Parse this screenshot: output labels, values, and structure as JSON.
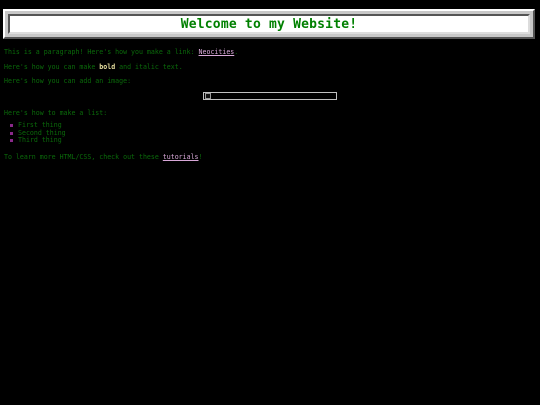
{
  "banner": {
    "title": "Welcome to my Website!"
  },
  "paragraph1": {
    "text": "This is a paragraph! Here's how you make a link: ",
    "link_label": "Neocities",
    "end": "."
  },
  "paragraph2": {
    "pre": "Here's how you can make ",
    "bold": "bold",
    "post": " and italic text."
  },
  "paragraph3": {
    "text": "Here's how you can add an image:"
  },
  "paragraph4": {
    "text": "Here's how to make a list:"
  },
  "list": {
    "items": [
      "First thing",
      "Second thing",
      "Third thing"
    ]
  },
  "paragraph5": {
    "text": "To learn more HTML/CSS, check out these ",
    "link_label": "tutorials",
    "end": "!"
  },
  "colors": {
    "background": "#000000",
    "text": "#0a6a0a",
    "title": "#008000",
    "link": "#d9a8d9",
    "bullet": "#8a2a8a"
  }
}
